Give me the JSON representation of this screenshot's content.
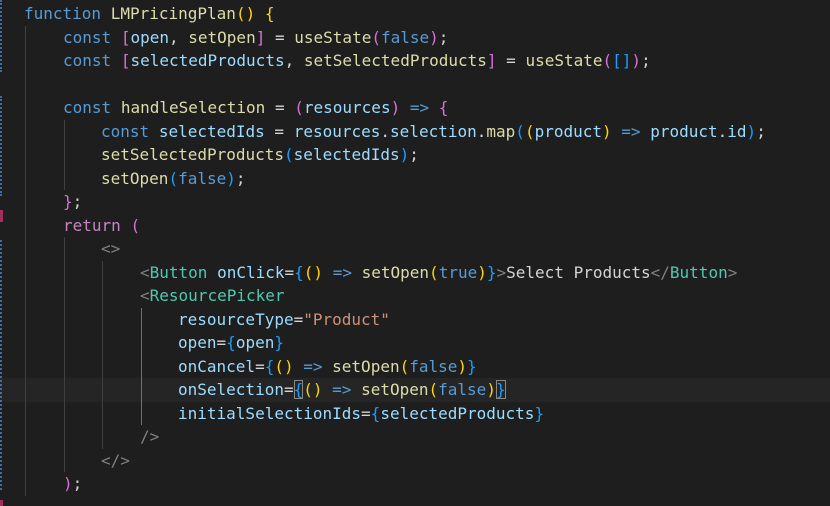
{
  "editor": {
    "language": "javascript-jsx",
    "theme": "dark",
    "colors": {
      "background": "#1e1e1e",
      "keyword": "#569cd6",
      "control": "#c586c0",
      "function": "#dcdcaa",
      "variable": "#9cdcfe",
      "string": "#ce9178",
      "tag": "#4ec9b0",
      "bracket_level_1": "#ffd700",
      "bracket_level_2": "#da70d6",
      "bracket_level_3": "#179fff"
    },
    "tokens": {
      "l1": {
        "t1": "function",
        "t2": "LMPricingPlan",
        "t3": "()",
        "t4": "{"
      },
      "l2": {
        "t1": "const",
        "t2": "[",
        "t3": "open",
        "t4": ",",
        "t5": "setOpen",
        "t6": "]",
        "t7": "=",
        "t8": "useState",
        "t9": "(",
        "t10": "false",
        "t11": ")",
        "t12": ";"
      },
      "l3": {
        "t1": "const",
        "t2": "[",
        "t3": "selectedProducts",
        "t4": ",",
        "t5": "setSelectedProducts",
        "t6": "]",
        "t7": "=",
        "t8": "useState",
        "t9": "(",
        "t10": "[]",
        "t11": ")",
        "t12": ";"
      },
      "l5": {
        "t1": "const",
        "t2": "handleSelection",
        "t3": "=",
        "t4": "(",
        "t5": "resources",
        "t6": ")",
        "t7": "=>",
        "t8": "{"
      },
      "l6": {
        "t1": "const",
        "t2": "selectedIds",
        "t3": "=",
        "t4": "resources",
        "t5": ".",
        "t6": "selection",
        "t7": ".",
        "t8": "map",
        "t9": "(",
        "t10": "(",
        "t11": "product",
        "t12": ")",
        "t13": "=>",
        "t14": "product",
        "t15": ".",
        "t16": "id",
        "t17": ")",
        "t18": ";"
      },
      "l7": {
        "t1": "setSelectedProducts",
        "t2": "(",
        "t3": "selectedIds",
        "t4": ")",
        "t5": ";"
      },
      "l8": {
        "t1": "setOpen",
        "t2": "(",
        "t3": "false",
        "t4": ")",
        "t5": ";"
      },
      "l9": {
        "t1": "}",
        "t2": ";"
      },
      "l10": {
        "t1": "return",
        "t2": "("
      },
      "l11": {
        "t1": "<>"
      },
      "l12": {
        "t1": "<",
        "t2": "Button",
        "t3": "onClick",
        "t4": "=",
        "t5": "{",
        "t6": "()",
        "t7": "=>",
        "t8": "setOpen",
        "t9": "(",
        "t10": "true",
        "t11": ")",
        "t12": "}",
        "t13": ">",
        "t14": "Select Products",
        "t15": "</",
        "t16": "Button",
        "t17": ">"
      },
      "l13": {
        "t1": "<",
        "t2": "ResourcePicker"
      },
      "l14": {
        "t1": "resourceType",
        "t2": "=",
        "t3": "\"Product\""
      },
      "l15": {
        "t1": "open",
        "t2": "=",
        "t3": "{",
        "t4": "open",
        "t5": "}"
      },
      "l16": {
        "t1": "onCancel",
        "t2": "=",
        "t3": "{",
        "t4": "()",
        "t5": "=>",
        "t6": "setOpen",
        "t7": "(",
        "t8": "false",
        "t9": ")",
        "t10": "}"
      },
      "l17": {
        "t1": "onSelection",
        "t2": "=",
        "t3": "{",
        "t4": "()",
        "t5": "=>",
        "t6": "setOpen",
        "t7": "(",
        "t8": "false",
        "t9": ")",
        "t10": "}"
      },
      "l18": {
        "t1": "initialSelectionIds",
        "t2": "=",
        "t3": "{",
        "t4": "selectedProducts",
        "t5": "}"
      },
      "l19": {
        "t1": "/>"
      },
      "l20": {
        "t1": "</>"
      },
      "l21": {
        "t1": ")",
        "t2": ";"
      }
    }
  }
}
